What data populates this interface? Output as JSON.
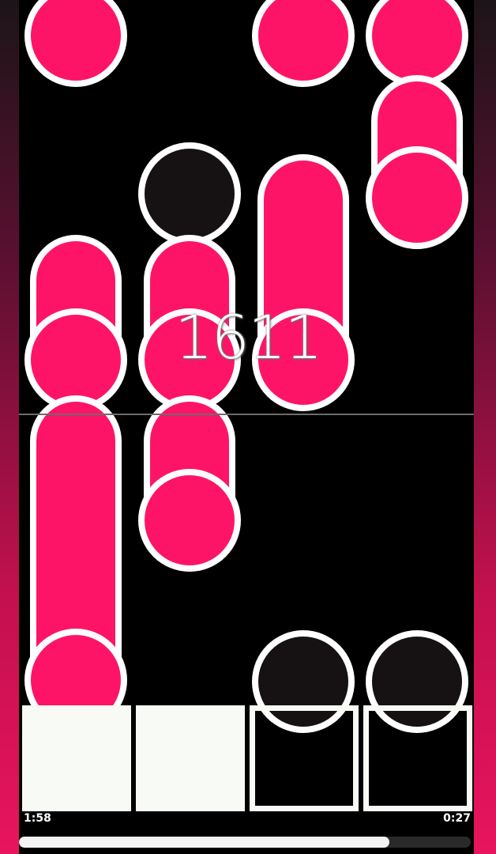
{
  "game": {
    "score": "1611",
    "time_elapsed": "1:58",
    "time_remaining": "0:27",
    "progress_fraction": 0.82
  },
  "colors": {
    "note": "#fe1467",
    "outline": "#ffffff",
    "empty_note": "#161213",
    "receptor_lit": "#f8faf6",
    "background": "#000000"
  },
  "receptors": [
    {
      "lane": 1,
      "state": "pressed"
    },
    {
      "lane": 2,
      "state": "pressed"
    },
    {
      "lane": 3,
      "state": "idle"
    },
    {
      "lane": 4,
      "state": "idle"
    }
  ]
}
